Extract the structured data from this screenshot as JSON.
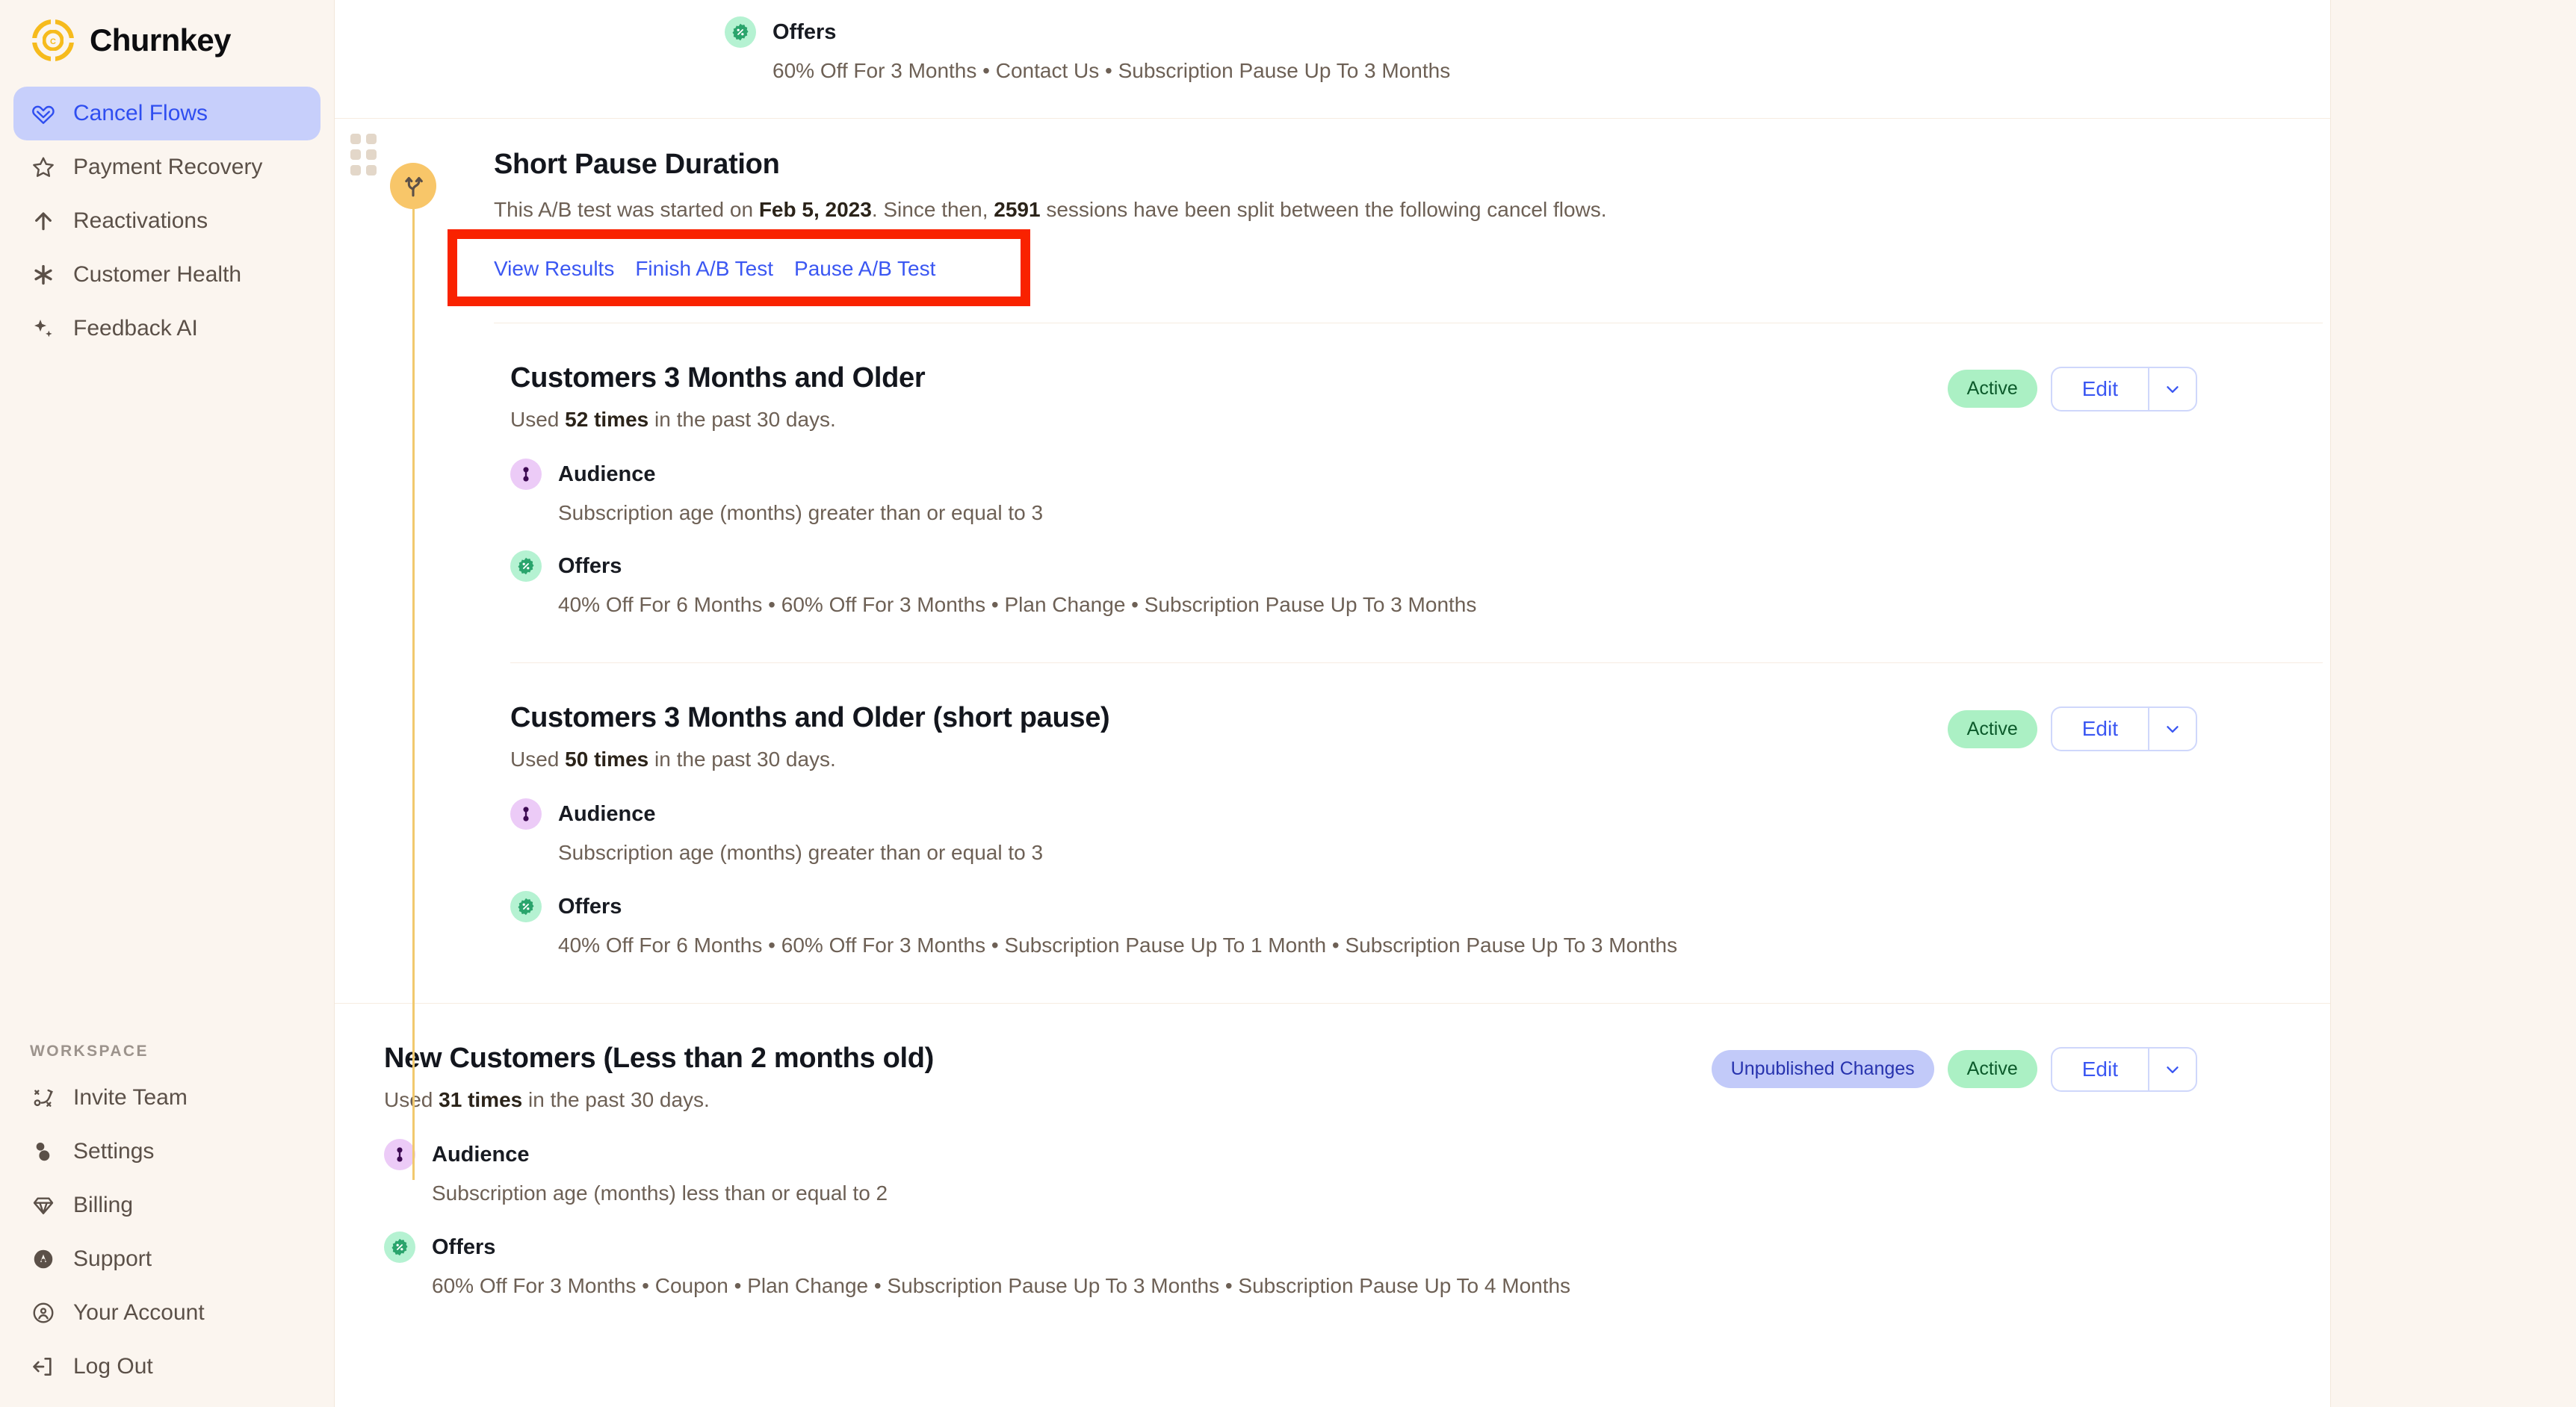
{
  "brand": {
    "name": "Churnkey",
    "logo_icon": "churnkey-logo-icon"
  },
  "sidebar": {
    "items": [
      {
        "label": "Cancel Flows",
        "icon": "heart-flow-icon",
        "active": true
      },
      {
        "label": "Payment Recovery",
        "icon": "star-icon",
        "active": false
      },
      {
        "label": "Reactivations",
        "icon": "arrow-up-icon",
        "active": false
      },
      {
        "label": "Customer Health",
        "icon": "asterisk-icon",
        "active": false
      },
      {
        "label": "Feedback AI",
        "icon": "sparkles-icon",
        "active": false
      }
    ],
    "workspace_label": "WORKSPACE",
    "workspace_items": [
      {
        "label": "Invite Team",
        "icon": "strategy-icon"
      },
      {
        "label": "Settings",
        "icon": "sliders-icon"
      },
      {
        "label": "Billing",
        "icon": "diamond-icon"
      },
      {
        "label": "Support",
        "icon": "lifebuoy-icon"
      },
      {
        "label": "Your Account",
        "icon": "user-circle-icon"
      },
      {
        "label": "Log Out",
        "icon": "logout-icon"
      }
    ]
  },
  "top_partial_card": {
    "offers_label": "Offers",
    "offers_value": "60% Off For 3 Months • Contact Us • Subscription Pause Up To 3 Months"
  },
  "ab_test": {
    "title": "Short Pause Duration",
    "desc_prefix": "This A/B test was started on ",
    "start_date": "Feb 5, 2023",
    "desc_middle": ". Since then, ",
    "sessions": "2591",
    "desc_suffix": " sessions have been split between the following cancel flows.",
    "actions": [
      {
        "label": "View Results"
      },
      {
        "label": "Finish A/B Test"
      },
      {
        "label": "Pause A/B Test"
      }
    ],
    "highlight_color": "#f92200",
    "variants": [
      {
        "title": "Customers 3 Months and Older",
        "used_prefix": "Used ",
        "used_count": "52 times",
        "used_suffix": " in the past 30 days.",
        "audience_label": "Audience",
        "audience_value": "Subscription age (months) greater than or equal to 3",
        "offers_label": "Offers",
        "offers_value": "40% Off For 6 Months • 60% Off For 3 Months • Plan Change • Subscription Pause Up To 3 Months",
        "status": "Active",
        "edit_label": "Edit"
      },
      {
        "title": "Customers 3 Months and Older (short pause)",
        "used_prefix": "Used ",
        "used_count": "50 times",
        "used_suffix": " in the past 30 days.",
        "audience_label": "Audience",
        "audience_value": "Subscription age (months) greater than or equal to 3",
        "offers_label": "Offers",
        "offers_value": "40% Off For 6 Months • 60% Off For 3 Months • Subscription Pause Up To 1 Month • Subscription Pause Up To 3 Months",
        "status": "Active",
        "edit_label": "Edit"
      }
    ]
  },
  "bottom_flow": {
    "title": "New Customers (Less than 2 months old)",
    "used_prefix": "Used ",
    "used_count": "31 times",
    "used_suffix": " in the past 30 days.",
    "audience_label": "Audience",
    "audience_value": "Subscription age (months) less than or equal to 2",
    "offers_label": "Offers",
    "offers_value": "60% Off For 3 Months • Coupon • Plan Change • Subscription Pause Up To 3 Months • Subscription Pause Up To 4 Months",
    "unpublished_badge": "Unpublished Changes",
    "status": "Active",
    "edit_label": "Edit"
  },
  "colors": {
    "accent_blue": "#3b57f2",
    "active_green_bg": "#abf0c4",
    "active_green_text": "#0c5a2b",
    "unpub_bg": "#c2caf9",
    "unpub_text": "#2733ae",
    "page_bg": "#fbf5ef",
    "card_bg": "#ffffff",
    "brand_yellow": "#f8c669"
  }
}
